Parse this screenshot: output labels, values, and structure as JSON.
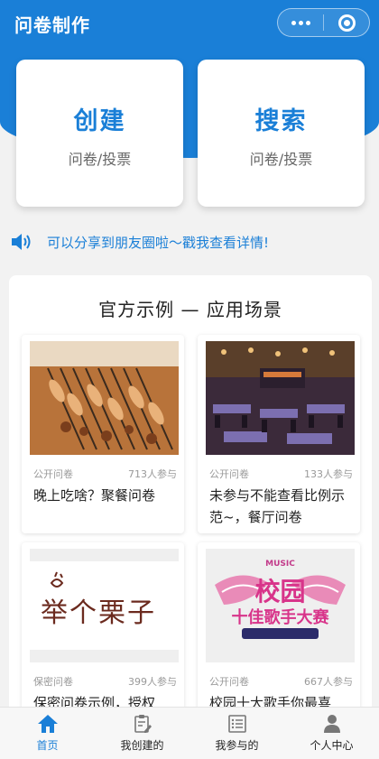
{
  "header": {
    "title": "问卷制作",
    "accent": "#1a7fd7",
    "capsule_icons": [
      "more-dots-icon",
      "target-icon"
    ]
  },
  "actions": [
    {
      "title": "创建",
      "subtitle": "问卷/投票"
    },
    {
      "title": "搜索",
      "subtitle": "问卷/投票"
    }
  ],
  "notice": {
    "icon": "speaker-icon",
    "text": "可以分享到朋友圈啦～戳我查看详情!"
  },
  "examples": {
    "section_title": "官方示例 — 应用场景",
    "cards": [
      {
        "type": "公开问卷",
        "count": "713人参与",
        "title": "晚上吃啥？聚餐问卷"
      },
      {
        "type": "公开问卷",
        "count": "133人参与",
        "title": "未参与不能查看比例示范~，餐厅问卷"
      },
      {
        "type": "保密问卷",
        "count": "399人参与",
        "title": "保密问卷示例，授权",
        "logo_text": "举个栗子"
      },
      {
        "type": "公开问卷",
        "count": "667人参与",
        "title": "校园十大歌手你最喜",
        "poster_main": "校园",
        "poster_sub": "十佳歌手大赛",
        "poster_top": "MUSIC"
      }
    ]
  },
  "tabbar": {
    "items": [
      {
        "label": "首页",
        "icon": "home-icon",
        "active": true
      },
      {
        "label": "我创建的",
        "icon": "clipboard-edit-icon"
      },
      {
        "label": "我参与的",
        "icon": "list-icon"
      },
      {
        "label": "个人中心",
        "icon": "user-icon"
      }
    ]
  }
}
